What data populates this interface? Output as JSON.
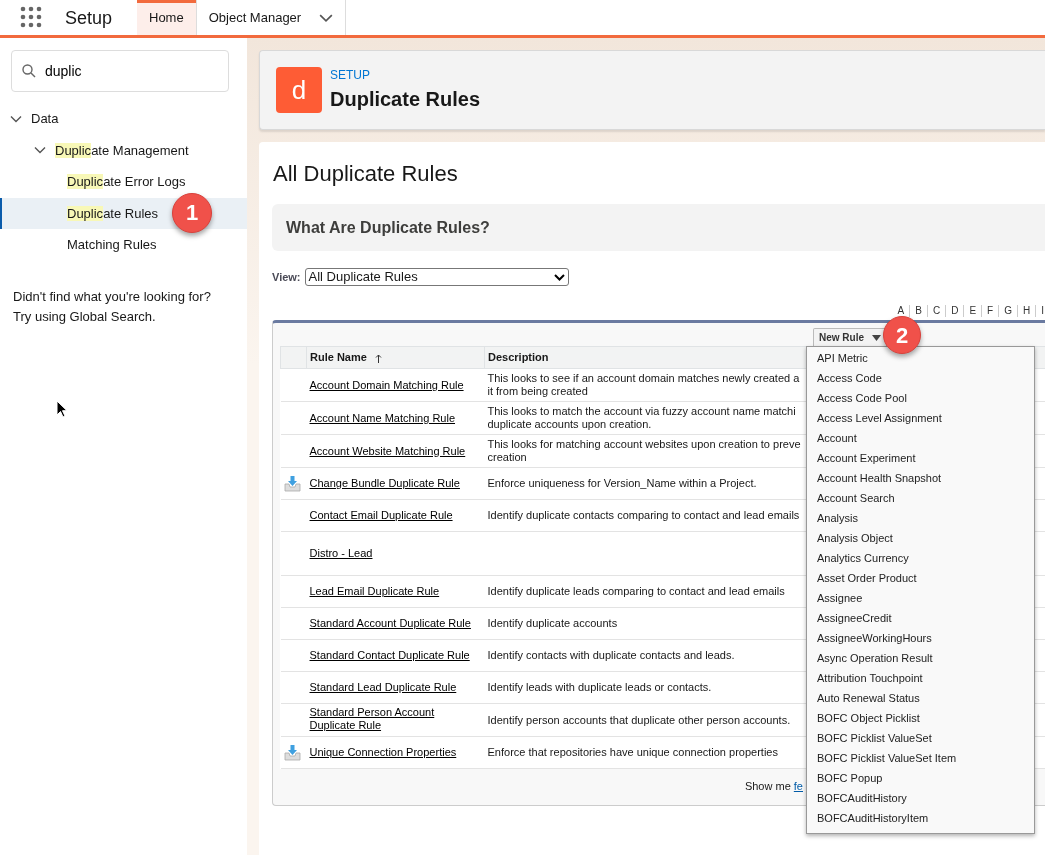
{
  "app_bar": {
    "app_name": "Setup",
    "tabs": [
      {
        "label": "Home",
        "selected": true,
        "has_menu": false
      },
      {
        "label": "Object Manager",
        "selected": false,
        "has_menu": true
      }
    ]
  },
  "sidebar": {
    "search": {
      "value": "duplic"
    },
    "tree": [
      {
        "label_parts": [
          {
            "text": "Data",
            "highlighted": false
          }
        ],
        "expanded": true,
        "selected": false,
        "children": [
          {
            "label_parts": [
              {
                "text": "Duplic",
                "highlighted": true
              },
              {
                "text": "ate Management",
                "highlighted": false
              }
            ],
            "expanded": true,
            "selected": false,
            "children": [
              {
                "label_parts": [
                  {
                    "text": "Duplic",
                    "highlighted": true
                  },
                  {
                    "text": "ate Error Logs",
                    "highlighted": false
                  }
                ],
                "selected": false
              },
              {
                "label_parts": [
                  {
                    "text": "Duplic",
                    "highlighted": true
                  },
                  {
                    "text": "ate Rules",
                    "highlighted": false
                  }
                ],
                "selected": true,
                "callout": "1"
              },
              {
                "label_parts": [
                  {
                    "text": "Matching Rules",
                    "highlighted": false
                  }
                ],
                "selected": false
              }
            ]
          }
        ]
      }
    ],
    "help_lines": [
      "Didn't find what you're looking for?",
      "Try using Global Search."
    ]
  },
  "page_header": {
    "icon_letter": "d",
    "eyebrow": "SETUP",
    "title": "Duplicate Rules"
  },
  "content": {
    "title": "All Duplicate Rules",
    "info_section": {
      "title": "What Are Duplicate Rules?"
    },
    "view": {
      "label": "View:",
      "value": "All Duplicate Rules"
    },
    "alphabet": [
      "A",
      "B",
      "C",
      "D",
      "E",
      "F",
      "G",
      "H",
      "I"
    ],
    "table": {
      "new_button": {
        "label": "New Rule",
        "callout": "2"
      },
      "columns": [
        {
          "label": "Rule Name",
          "sorted": true
        },
        {
          "label": "Description",
          "sorted": false
        }
      ],
      "rows": [
        {
          "name": "Account Domain Matching Rule",
          "description_lines": [
            "This looks to see if an account domain matches newly created a",
            "it from being created"
          ],
          "packaged": false
        },
        {
          "name": "Account Name Matching Rule",
          "description_lines": [
            "This looks to match the account via fuzzy account name matchi",
            "duplicate accounts upon creation."
          ],
          "packaged": false
        },
        {
          "name": "Account Website Matching Rule",
          "description_lines": [
            "This looks for matching account websites upon creation to preve",
            "creation"
          ],
          "packaged": false
        },
        {
          "name": "Change Bundle Duplicate Rule",
          "description_lines": [
            "Enforce uniqueness for Version_Name within a Project."
          ],
          "packaged": true
        },
        {
          "name": "Contact Email Duplicate Rule",
          "description_lines": [
            "Identify duplicate contacts comparing to contact and lead emails"
          ],
          "packaged": false
        },
        {
          "name": "Distro - Lead",
          "description_lines": [],
          "packaged": false
        },
        {
          "name": "Lead Email Duplicate Rule",
          "description_lines": [
            "Identify duplicate leads comparing to contact and lead emails"
          ],
          "packaged": false
        },
        {
          "name": "Standard Account Duplicate Rule",
          "description_lines": [
            "Identify duplicate accounts"
          ],
          "packaged": false
        },
        {
          "name": "Standard Contact Duplicate Rule",
          "description_lines": [
            "Identify contacts with duplicate contacts and leads."
          ],
          "packaged": false
        },
        {
          "name": "Standard Lead Duplicate Rule",
          "description_lines": [
            "Identify leads with duplicate leads or contacts."
          ],
          "packaged": false
        },
        {
          "name": "Standard Person Account Duplicate Rule",
          "description_lines": [
            "Identify person accounts that duplicate other person accounts."
          ],
          "packaged": false
        },
        {
          "name": "Unique Connection Properties",
          "description_lines": [
            "Enforce that repositories have unique connection properties"
          ],
          "packaged": true
        }
      ],
      "footer": {
        "text": "Show me",
        "link": "fe"
      }
    }
  },
  "dropdown": {
    "open": true,
    "items": [
      "API Metric",
      "Access Code",
      "Access Code Pool",
      "Access Level Assignment",
      "Account",
      "Account Experiment",
      "Account Health Snapshot",
      "Account Search",
      "Analysis",
      "Analysis Object",
      "Analytics Currency",
      "Asset Order Product",
      "Assignee",
      "AssigneeCredit",
      "AssigneeWorkingHours",
      "Async Operation Result",
      "Attribution Touchpoint",
      "Auto Renewal Status",
      "BOFC Object Picklist",
      "BOFC Picklist ValueSet",
      "BOFC Picklist ValueSet Item",
      "BOFC Popup",
      "BOFCAuditHistory",
      "BOFCAuditHistoryItem"
    ]
  }
}
